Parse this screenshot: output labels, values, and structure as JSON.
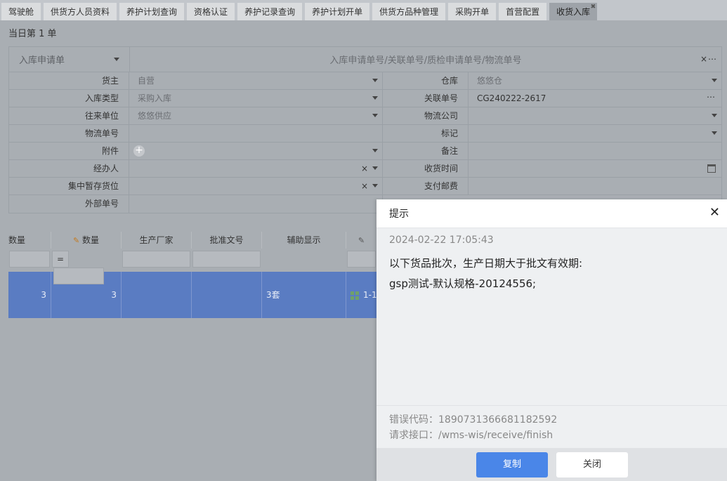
{
  "tabs": [
    "驾驶舱",
    "供货方人员资料",
    "养护计划查询",
    "资格认证",
    "养护记录查询",
    "养护计划开单",
    "供货方品种管理",
    "采购开单",
    "首营配置",
    "收货入库"
  ],
  "active_tab": "收货入库",
  "count_text": "当日第 1 单",
  "search": {
    "type": "入库申请单",
    "placeholder": "入库申请单号/关联单号/质检申请单号/物流单号"
  },
  "form": {
    "owner_label": "货主",
    "owner_value": "自营",
    "warehouse_label": "仓库",
    "warehouse_value": "悠悠仓",
    "in_type_label": "入库类型",
    "in_type_value": "采购入库",
    "ref_no_label": "关联单号",
    "ref_no_value": "CG240222-2617",
    "partner_label": "往来单位",
    "partner_value": "悠悠供应",
    "logistics_co_label": "物流公司",
    "logistics_no_label": "物流单号",
    "tag_label": "标记",
    "attach_label": "附件",
    "remark_label": "备注",
    "handler_label": "经办人",
    "receive_time_label": "收货时间",
    "temp_loc_label": "集中暂存货位",
    "postage_label": "支付邮费",
    "external_no_label": "外部单号"
  },
  "grid": {
    "headers": [
      "数量",
      "数量",
      "生产厂家",
      "批准文号",
      "辅助显示",
      ""
    ],
    "eq": "=",
    "row": [
      "3",
      "3",
      "",
      "",
      "3套",
      "1-1"
    ]
  },
  "dialog": {
    "title": "提示",
    "time": "2024-02-22 17:05:43",
    "message1": "以下货品批次，生产日期大于批文有效期:",
    "message2": "gsp测试-默认规格-20124556;",
    "error_code": "错误代码：1890731366681182592",
    "api": "请求接口：/wms-wis/receive/finish",
    "copy_label": "复制",
    "close_label": "关闭"
  }
}
